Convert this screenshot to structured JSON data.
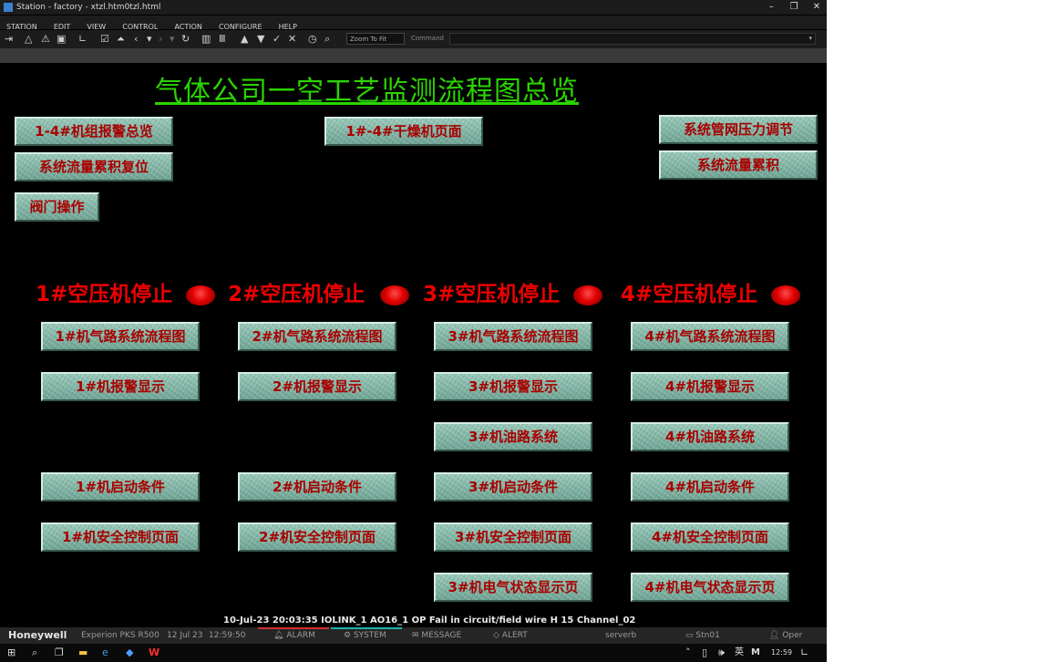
{
  "window": {
    "title": "Station - factory - xtzl.htm0tzl.html",
    "controls": [
      "–",
      "❐",
      "✕"
    ]
  },
  "menu": [
    "STATION",
    "EDIT",
    "VIEW",
    "CONTROL",
    "ACTION",
    "CONFIGURE",
    "HELP"
  ],
  "toolbar": {
    "zoom_value": "Zoom To Fit",
    "command_label": "Command",
    "command_value": ""
  },
  "display": {
    "title": "气体公司一空工艺监测流程图总览",
    "top_buttons": {
      "alarm_overview": "1-4#机组报警总览",
      "dryer_page": "1#-4#干燥机页面",
      "flow_reset": "系统流量累积复位",
      "valve_operation": "阀门操作",
      "pressure_regulation": "系统管网压力调节",
      "flow_total": "系统流量累积"
    },
    "compressors": [
      {
        "status": "1#空压机停止",
        "lamp_color": "#e00000",
        "buttons": [
          "1#机气路系统流程图",
          "1#机报警显示",
          "1#机启动条件",
          "1#机安全控制页面"
        ]
      },
      {
        "status": "2#空压机停止",
        "lamp_color": "#e00000",
        "buttons": [
          "2#机气路系统流程图",
          "2#机报警显示",
          "2#机启动条件",
          "2#机安全控制页面"
        ]
      },
      {
        "status": "3#空压机停止",
        "lamp_color": "#e00000",
        "buttons": [
          "3#机气路系统流程图",
          "3#机报警显示",
          "3#机油路系统",
          "3#机启动条件",
          "3#机安全控制页面",
          "3#机电气状态显示页"
        ]
      },
      {
        "status": "4#空压机停止",
        "lamp_color": "#e00000",
        "buttons": [
          "4#机气路系统流程图",
          "4#机报警显示",
          "4#机油路系统",
          "4#机启动条件",
          "4#机安全控制页面",
          "4#机电气状态显示页"
        ]
      }
    ]
  },
  "alarm_line": "10-Jul-23  20:03:35  IOLINK_1   AO16_1   OP Fail in circuit/field wire  H 15 Channel_02",
  "statusbar": {
    "brand": "Honeywell",
    "product": "Experion PKS R500",
    "date": "12 Jul 23",
    "time": "12:59:50",
    "alarm": "ALARM",
    "system": "SYSTEM",
    "message": "MESSAGE",
    "alert": "ALERT",
    "server": "serverb",
    "station": "Stn01",
    "operator": "Oper"
  },
  "colors": {
    "title": "#2bd400",
    "button_face": "#7fb3a4",
    "button_text": "#a80000",
    "status_text": "#ee0000",
    "alarm_tab": "#d03030",
    "system_tab": "#1fb0b0"
  },
  "taskbar": {
    "time": "12:59",
    "ime": "英",
    "ime_mode": "M"
  }
}
